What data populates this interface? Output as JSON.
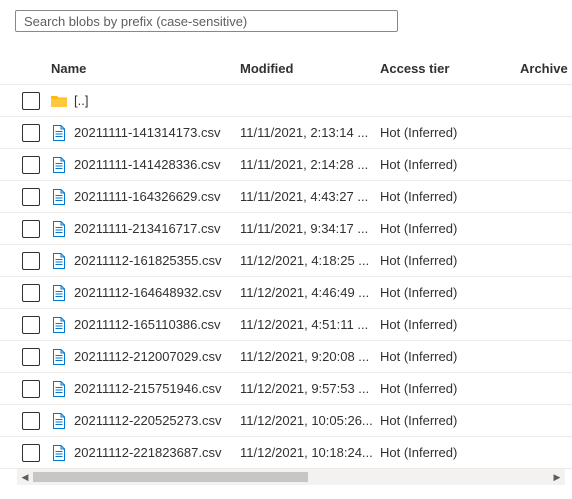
{
  "search": {
    "placeholder": "Search blobs by prefix (case-sensitive)"
  },
  "columns": {
    "name": "Name",
    "modified": "Modified",
    "access_tier": "Access tier",
    "archive": "Archive"
  },
  "parent_folder": {
    "label": "[..]",
    "icon": "folder-icon"
  },
  "files": [
    {
      "name": "20211111-141314173.csv",
      "modified": "11/11/2021, 2:13:14 ...",
      "tier": "Hot (Inferred)"
    },
    {
      "name": "20211111-141428336.csv",
      "modified": "11/11/2021, 2:14:28 ...",
      "tier": "Hot (Inferred)"
    },
    {
      "name": "20211111-164326629.csv",
      "modified": "11/11/2021, 4:43:27 ...",
      "tier": "Hot (Inferred)"
    },
    {
      "name": "20211111-213416717.csv",
      "modified": "11/11/2021, 9:34:17 ...",
      "tier": "Hot (Inferred)"
    },
    {
      "name": "20211112-161825355.csv",
      "modified": "11/12/2021, 4:18:25 ...",
      "tier": "Hot (Inferred)"
    },
    {
      "name": "20211112-164648932.csv",
      "modified": "11/12/2021, 4:46:49 ...",
      "tier": "Hot (Inferred)"
    },
    {
      "name": "20211112-165110386.csv",
      "modified": "11/12/2021, 4:51:11 ...",
      "tier": "Hot (Inferred)"
    },
    {
      "name": "20211112-212007029.csv",
      "modified": "11/12/2021, 9:20:08 ...",
      "tier": "Hot (Inferred)"
    },
    {
      "name": "20211112-215751946.csv",
      "modified": "11/12/2021, 9:57:53 ...",
      "tier": "Hot (Inferred)"
    },
    {
      "name": "20211112-220525273.csv",
      "modified": "11/12/2021, 10:05:26...",
      "tier": "Hot (Inferred)"
    },
    {
      "name": "20211112-221823687.csv",
      "modified": "11/12/2021, 10:18:24...",
      "tier": "Hot (Inferred)"
    }
  ],
  "icons": {
    "file": "document-icon",
    "folder": "folder-icon"
  },
  "colors": {
    "folder": "#ffb900",
    "file": "#0078d4",
    "border": "#edebe9"
  }
}
